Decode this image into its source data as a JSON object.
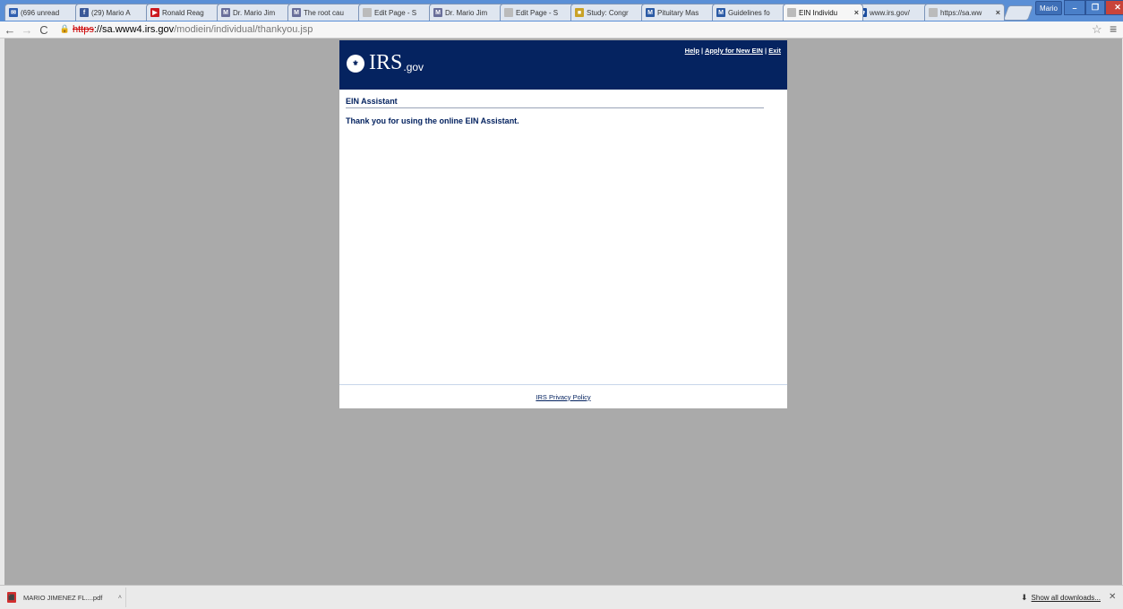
{
  "browser": {
    "tabs": [
      {
        "label": "(696 unread",
        "icon": "gmail-icon",
        "color": "#2f5fb0",
        "glyph": "✉"
      },
      {
        "label": "(29) Mario A",
        "icon": "facebook-icon",
        "color": "#3b5998",
        "glyph": "f"
      },
      {
        "label": "Ronald Reag",
        "icon": "youtube-icon",
        "color": "#cc181e",
        "glyph": "▶"
      },
      {
        "label": "Dr. Mario Jim",
        "icon": "site-icon",
        "color": "#6a6f9a",
        "glyph": "M"
      },
      {
        "label": "The root cau",
        "icon": "site-icon",
        "color": "#6a6f9a",
        "glyph": "M"
      },
      {
        "label": "Edit Page - S",
        "icon": "page-icon",
        "color": "#bbbbbb",
        "glyph": ""
      },
      {
        "label": "Dr. Mario Jim",
        "icon": "site-icon",
        "color": "#6a6f9a",
        "glyph": "M"
      },
      {
        "label": "Edit Page - S",
        "icon": "page-icon",
        "color": "#bbbbbb",
        "glyph": ""
      },
      {
        "label": "Study: Congr",
        "icon": "news-icon",
        "color": "#c9a227",
        "glyph": "■"
      },
      {
        "label": "Pituitary Mas",
        "icon": "m-icon",
        "color": "#2c5ba5",
        "glyph": "M"
      },
      {
        "label": "Guidelines fo",
        "icon": "m-icon",
        "color": "#2c5ba5",
        "glyph": "M"
      },
      {
        "label": "EIN Individu",
        "icon": "page-icon",
        "color": "#bbbbbb",
        "glyph": "",
        "active": true
      },
      {
        "label": "www.irs.gov/",
        "icon": "irs-icon",
        "color": "#1a4c9e",
        "glyph": "✿"
      },
      {
        "label": "https://sa.ww",
        "icon": "page-icon",
        "color": "#bbbbbb",
        "glyph": ""
      }
    ],
    "profile_label": "Mario",
    "url": {
      "scheme": "https",
      "host": "://sa.www4.irs.gov",
      "path": "/modiein/individual/thankyou.jsp"
    }
  },
  "irs": {
    "logo_main": "IRS",
    "logo_sub": ".gov",
    "seal_glyph": "⚜",
    "links": {
      "help": "Help",
      "sep1": " | ",
      "apply": "Apply for New EIN",
      "sep2": " | ",
      "exit": "Exit"
    },
    "section_title": "EIN Assistant",
    "message": "Thank you for using the online EIN Assistant.",
    "footer_link": "IRS Privacy Policy"
  },
  "downloads": {
    "item": "MARIO JIMENEZ FL....pdf",
    "show_all": "Show all downloads..."
  }
}
